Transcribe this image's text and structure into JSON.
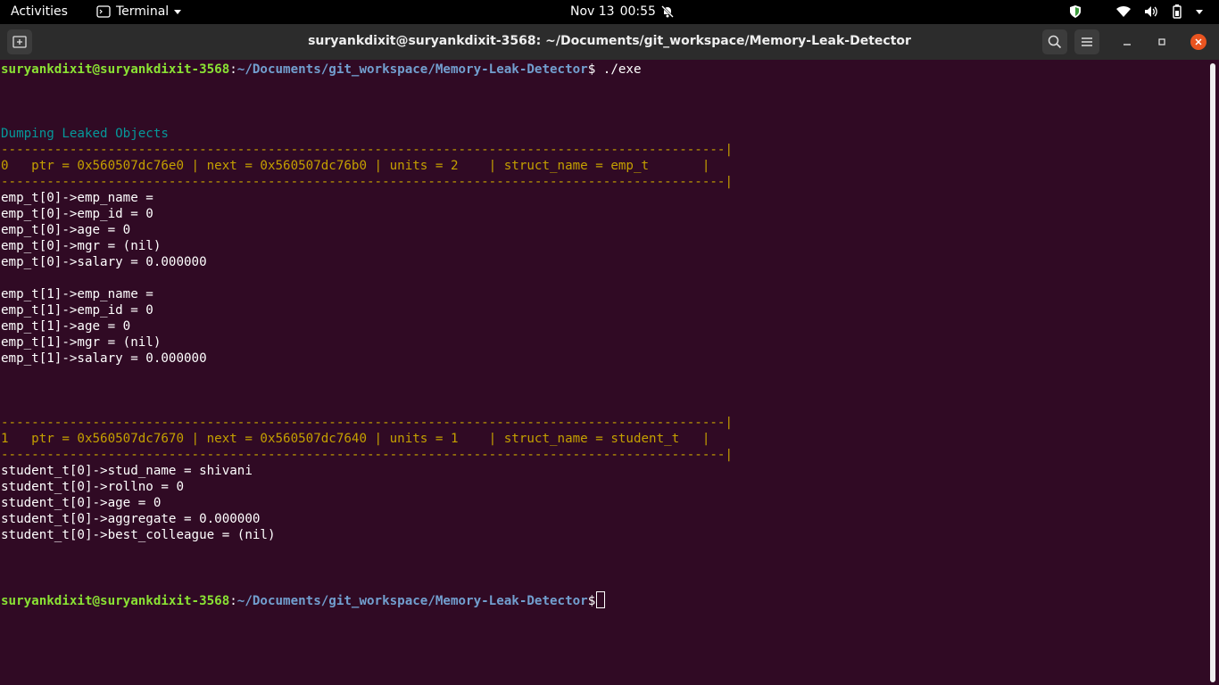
{
  "topbar": {
    "activities": "Activities",
    "app_name": "Terminal",
    "date": "Nov 13",
    "time": "00:55"
  },
  "window": {
    "title": "suryankdixit@suryankdixit-3568: ~/Documents/git_workspace/Memory-Leak-Detector"
  },
  "terminal": {
    "user_host": "suryankdixit@suryankdixit-3568",
    "path": "~/Documents/git_workspace/Memory-Leak-Detector",
    "prompt_sign": "$",
    "command": " ./exe",
    "heading": "Dumping Leaked Objects",
    "divider": "-----------------------------------------------------------------------------------------------|",
    "records": [
      {
        "header": "0   ptr = 0x560507dc76e0 | next = 0x560507dc76b0 | units = 2    | struct_name = emp_t       |",
        "groups": [
          [
            "emp_t[0]->emp_name =",
            "emp_t[0]->emp_id = 0",
            "emp_t[0]->age = 0",
            "emp_t[0]->mgr = (nil)",
            "emp_t[0]->salary = 0.000000"
          ],
          [
            "emp_t[1]->emp_name =",
            "emp_t[1]->emp_id = 0",
            "emp_t[1]->age = 0",
            "emp_t[1]->mgr = (nil)",
            "emp_t[1]->salary = 0.000000"
          ]
        ]
      },
      {
        "header": "1   ptr = 0x560507dc7670 | next = 0x560507dc7640 | units = 1    | struct_name = student_t   |",
        "groups": [
          [
            "student_t[0]->stud_name = shivani",
            "student_t[0]->rollno = 0",
            "student_t[0]->age = 0",
            "student_t[0]->aggregate = 0.000000",
            "student_t[0]->best_colleague = (nil)"
          ]
        ]
      }
    ]
  }
}
